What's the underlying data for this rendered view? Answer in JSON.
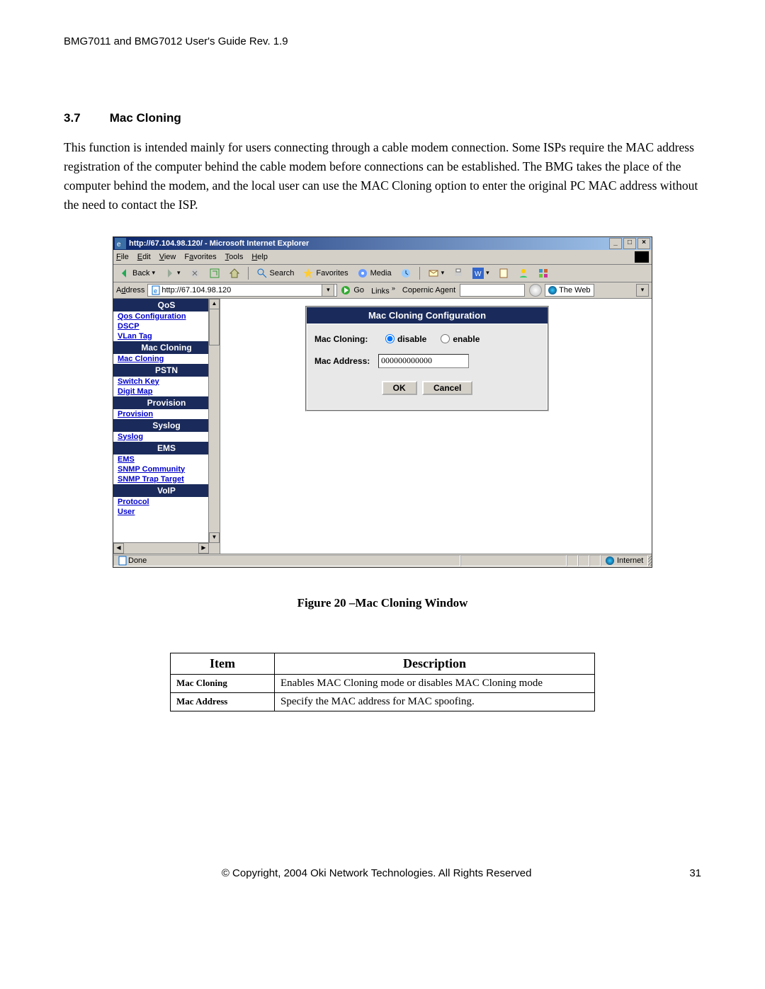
{
  "doc_header": "BMG7011 and BMG7012 User's Guide Rev. 1.9",
  "section": {
    "number": "3.7",
    "title": "Mac Cloning"
  },
  "paragraph": "This function is intended mainly for users connecting through a cable modem connection. Some ISPs require the MAC address registration of the computer behind the cable modem before connections can be established. The BMG takes the place of the computer behind the modem, and the local user can use the MAC Cloning option to enter the original PC MAC address without the need to contact the ISP.",
  "figure_caption": "Figure 20 –Mac Cloning Window",
  "ie": {
    "title": "http://67.104.98.120/ - Microsoft Internet Explorer",
    "menus": {
      "file": "File",
      "edit": "Edit",
      "view": "View",
      "favorites": "Favorites",
      "tools": "Tools",
      "help": "Help"
    },
    "toolbar": {
      "back": "Back",
      "search": "Search",
      "favorites": "Favorites",
      "media": "Media"
    },
    "addressbar": {
      "label": "Address",
      "url": "http://67.104.98.120",
      "go": "Go",
      "links": "Links",
      "copernic": "Copernic Agent",
      "theweb": "The Web"
    },
    "status": {
      "done": "Done",
      "zone": "Internet"
    }
  },
  "sidebar": {
    "groups": [
      {
        "header": "QoS",
        "links": [
          "Qos Configuration",
          "DSCP",
          "VLan Tag"
        ]
      },
      {
        "header": "Mac Cloning",
        "links": [
          "Mac Cloning"
        ]
      },
      {
        "header": "PSTN",
        "links": [
          "Switch Key",
          "Digit Map"
        ]
      },
      {
        "header": "Provision",
        "links": [
          "Provision"
        ]
      },
      {
        "header": "Syslog",
        "links": [
          "Syslog"
        ]
      },
      {
        "header": "EMS",
        "links": [
          "EMS",
          "SNMP Community",
          "SNMP Trap Target"
        ]
      },
      {
        "header": "VoIP",
        "links": [
          "Protocol",
          "User"
        ]
      }
    ]
  },
  "config": {
    "title": "Mac Cloning Configuration",
    "row_cloning_label": "Mac Cloning:",
    "opt_disable": "disable",
    "opt_enable": "enable",
    "row_addr_label": "Mac Address:",
    "addr_value": "000000000000",
    "btn_ok": "OK",
    "btn_cancel": "Cancel"
  },
  "desc_table": {
    "h_item": "Item",
    "h_desc": "Description",
    "rows": [
      {
        "item": "Mac Cloning",
        "desc": "Enables MAC Cloning mode or disables MAC Cloning mode"
      },
      {
        "item": "Mac Address",
        "desc": "Specify the MAC address for MAC spoofing."
      }
    ]
  },
  "footer": {
    "copyright": "© Copyright, 2004 Oki Network Technologies. All Rights Reserved",
    "page": "31"
  }
}
